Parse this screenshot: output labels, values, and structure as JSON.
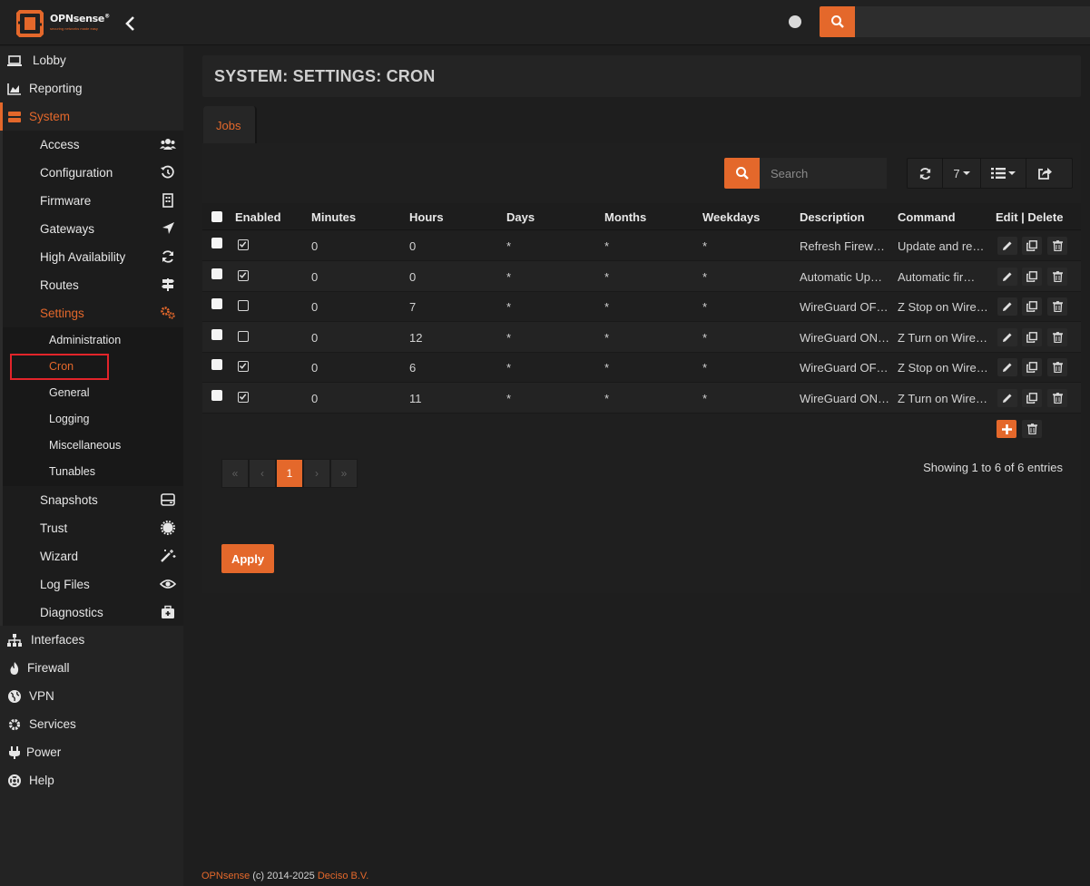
{
  "brand": {
    "name": "OPNsense",
    "trademark": "®",
    "tagline": "securing networks made easy"
  },
  "topbar": {
    "search_placeholder": ""
  },
  "sidebar": {
    "top_items": [
      {
        "label": "Lobby",
        "icon": "laptop-icon"
      },
      {
        "label": "Reporting",
        "icon": "chart-area-icon"
      },
      {
        "label": "System",
        "icon": "server-icon"
      }
    ],
    "system_items": [
      {
        "label": "Access",
        "icon": "users-icon"
      },
      {
        "label": "Configuration",
        "icon": "history-icon"
      },
      {
        "label": "Firmware",
        "icon": "building-icon"
      },
      {
        "label": "Gateways",
        "icon": "location-arrow-icon"
      },
      {
        "label": "High Availability",
        "icon": "refresh-icon"
      },
      {
        "label": "Routes",
        "icon": "map-signs-icon"
      },
      {
        "label": "Settings",
        "icon": "cogs-icon"
      }
    ],
    "settings_items": [
      {
        "label": "Administration"
      },
      {
        "label": "Cron"
      },
      {
        "label": "General"
      },
      {
        "label": "Logging"
      },
      {
        "label": "Miscellaneous"
      },
      {
        "label": "Tunables"
      }
    ],
    "system_items_after": [
      {
        "label": "Snapshots",
        "icon": "hdd-icon"
      },
      {
        "label": "Trust",
        "icon": "certificate-icon"
      },
      {
        "label": "Wizard",
        "icon": "magic-icon"
      },
      {
        "label": "Log Files",
        "icon": "eye-icon"
      },
      {
        "label": "Diagnostics",
        "icon": "medkit-icon"
      }
    ],
    "bottom_items": [
      {
        "label": "Interfaces",
        "icon": "sitemap-icon"
      },
      {
        "label": "Firewall",
        "icon": "fire-icon"
      },
      {
        "label": "VPN",
        "icon": "globe-icon"
      },
      {
        "label": "Services",
        "icon": "cog-icon"
      },
      {
        "label": "Power",
        "icon": "plug-icon"
      },
      {
        "label": "Help",
        "icon": "life-ring-icon"
      }
    ]
  },
  "page": {
    "title": "SYSTEM: SETTINGS: CRON",
    "tab": "Jobs"
  },
  "grid": {
    "search_placeholder": "Search",
    "page_size": "7",
    "columns": [
      "Enabled",
      "Minutes",
      "Hours",
      "Days",
      "Months",
      "Weekdays",
      "Description",
      "Command",
      "Edit | Delete"
    ],
    "rows": [
      {
        "enabled": true,
        "minutes": "0",
        "hours": "0",
        "days": "*",
        "months": "*",
        "weekdays": "*",
        "description": "Refresh Firew…",
        "command": "Update and re…"
      },
      {
        "enabled": true,
        "minutes": "0",
        "hours": "0",
        "days": "*",
        "months": "*",
        "weekdays": "*",
        "description": "Automatic Up…",
        "command": "Automatic fir…"
      },
      {
        "enabled": false,
        "minutes": "0",
        "hours": "7",
        "days": "*",
        "months": "*",
        "weekdays": "*",
        "description": "WireGuard OF…",
        "command": "Z Stop on Wire…"
      },
      {
        "enabled": false,
        "minutes": "0",
        "hours": "12",
        "days": "*",
        "months": "*",
        "weekdays": "*",
        "description": "WireGuard ON…",
        "command": "Z Turn on Wire…"
      },
      {
        "enabled": true,
        "minutes": "0",
        "hours": "6",
        "days": "*",
        "months": "*",
        "weekdays": "*",
        "description": "WireGuard OF…",
        "command": "Z Stop on Wire…"
      },
      {
        "enabled": true,
        "minutes": "0",
        "hours": "11",
        "days": "*",
        "months": "*",
        "weekdays": "*",
        "description": "WireGuard ON…",
        "command": "Z Turn on Wire…"
      }
    ],
    "pagination": {
      "first": "«",
      "prev": "‹",
      "current": "1",
      "next": "›",
      "last": "»"
    },
    "info": "Showing 1 to 6 of 6 entries",
    "apply_label": "Apply"
  },
  "footer": {
    "brand": "OPNsense",
    "text": " (c) 2014-2025 ",
    "company": "Deciso B.V."
  },
  "colors": {
    "accent": "#e4682b",
    "background": "#1e1e1e",
    "highlight_box": "#e2242a"
  }
}
